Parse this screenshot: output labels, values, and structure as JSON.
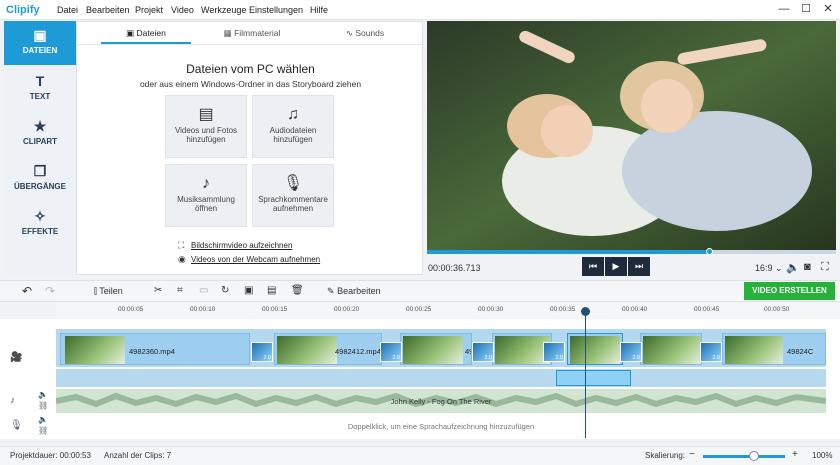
{
  "app": {
    "logo": "Clipify"
  },
  "menu": [
    "Datei",
    "Bearbeiten",
    "Projekt",
    "Video",
    "Werkzeuge",
    "Einstellungen",
    "Hilfe"
  ],
  "window": {
    "minimize": "—",
    "maximize": "☐",
    "close": "✕"
  },
  "sidebar": {
    "items": [
      {
        "label": "DATEIEN",
        "icon": "files-icon",
        "glyph": "▣"
      },
      {
        "label": "TEXT",
        "icon": "text-icon",
        "glyph": "T"
      },
      {
        "label": "CLIPART",
        "icon": "star-icon",
        "glyph": "★"
      },
      {
        "label": "ÜBERGÄNGE",
        "icon": "transitions-icon",
        "glyph": "❐"
      },
      {
        "label": "EFFEKTE",
        "icon": "magic-wand-icon",
        "glyph": "✧"
      }
    ]
  },
  "tabs": [
    {
      "label": "Dateien",
      "icon": "image-icon",
      "glyph": "▣"
    },
    {
      "label": "Filmmaterial",
      "icon": "film-icon",
      "glyph": "▦"
    },
    {
      "label": "Sounds",
      "icon": "waveform-icon",
      "glyph": "∿"
    }
  ],
  "main": {
    "heading": "Dateien vom PC wählen",
    "subheading": "oder aus einem Windows-Ordner in das Storyboard ziehen",
    "tiles": [
      {
        "label1": "Videos und Fotos",
        "label2": "hinzufügen",
        "icon": "video-photo-icon",
        "glyph": "▤"
      },
      {
        "label1": "Audiodateien",
        "label2": "hinzufügen",
        "icon": "audio-file-icon",
        "glyph": "♫"
      },
      {
        "label1": "Musiksammlung",
        "label2": "öffnen",
        "icon": "music-note-icon",
        "glyph": "♪"
      },
      {
        "label1": "Sprachkommentare",
        "label2": "aufnehmen",
        "icon": "microphone-icon",
        "glyph": "🎙"
      }
    ],
    "links": [
      {
        "label": "Bildschirmvideo aufzeichnen",
        "icon": "screen-record-icon",
        "glyph": "⛶"
      },
      {
        "label": "Videos von der Webcam aufnehmen",
        "icon": "webcam-icon",
        "glyph": "◉"
      }
    ]
  },
  "player": {
    "timecode": "00:00:36.713",
    "progress": 0.69,
    "aspect": "16:9",
    "prev": "⏮",
    "play": "▶",
    "next": "⏭"
  },
  "toolbar": {
    "undo": "↶",
    "redo": "↷",
    "split": "Teilen",
    "edit": "Bearbeiten",
    "create": "VIDEO ERSTELLEN"
  },
  "ruler": [
    "00:00:05",
    "00:00:10",
    "00:00:15",
    "00:00:20",
    "00:00:25",
    "00:00:30",
    "00:00:35",
    "00:00:40",
    "00:00:45",
    "00:00:50"
  ],
  "clips": [
    {
      "label": "4982360.mp4"
    },
    {
      "label": "4982412.mp4"
    },
    {
      "label": "49"
    },
    {
      "label": "49824C"
    }
  ],
  "transition_label": "2.0",
  "audio": {
    "track_label": "John Kelly - Fog On The River"
  },
  "voice": {
    "placeholder": "Doppelklick, um eine Sprachaufzeichnung hinzuzufügen"
  },
  "status": {
    "duration": "Projektdauer:  00:00:53",
    "clips": "Anzahl der Clips: 7",
    "scale_label": "Skalierung:",
    "zoom_minus": "−",
    "zoom_plus": "+",
    "zoom": "100%",
    "zoom_level": 0.62
  },
  "colors": {
    "accent": "#1e9ad6",
    "create": "#26b23a",
    "dark": "#1f2b3a"
  }
}
